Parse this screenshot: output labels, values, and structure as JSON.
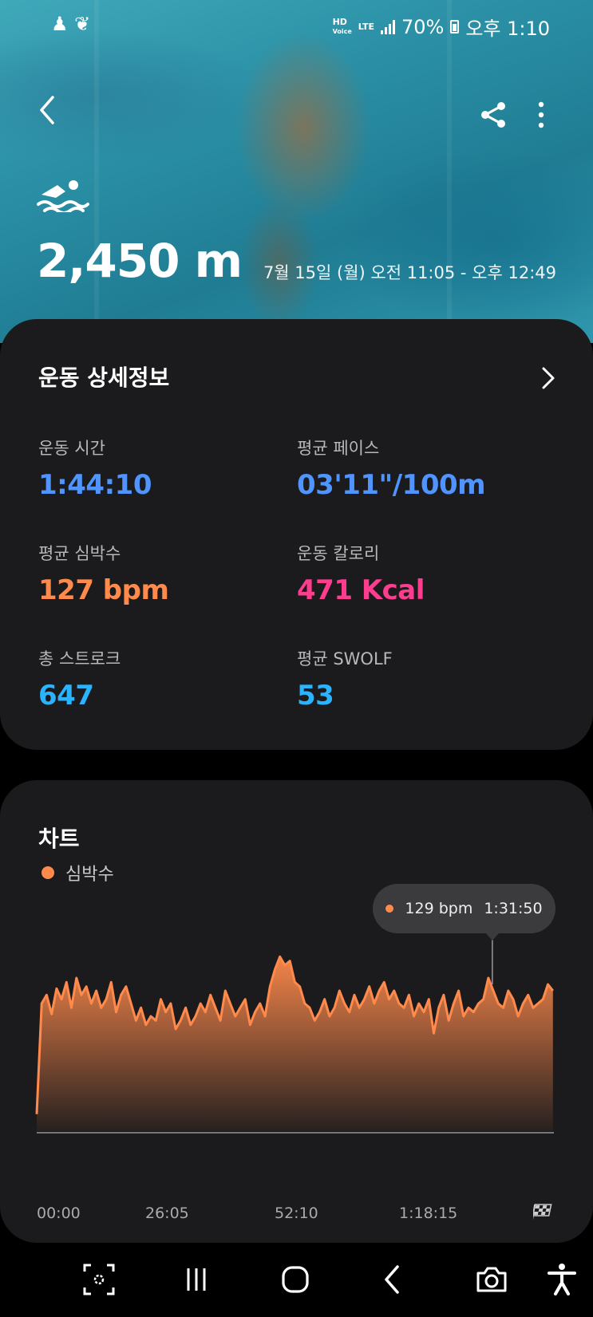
{
  "status_bar": {
    "hd_voice": "HD",
    "voice_sub": "Voice",
    "lte": "LTE",
    "battery": "70%",
    "time": "오후 1:10"
  },
  "hero": {
    "distance": "2,450 m",
    "datetime": "7월 15일 (월) 오전 11:05 - 오후 12:49"
  },
  "details": {
    "title": "운동 상세정보",
    "stats": [
      {
        "label": "운동 시간",
        "value": "1:44:10",
        "color": "#4f94ff"
      },
      {
        "label": "평균 페이스",
        "value": "03'11\"/100m",
        "color": "#4f94ff"
      },
      {
        "label": "평균 심박수",
        "value": "127 bpm",
        "color": "#ff8a4c"
      },
      {
        "label": "운동 칼로리",
        "value": "471 Kcal",
        "color": "#ff3c8e"
      },
      {
        "label": "총 스트로크",
        "value": "647",
        "color": "#2ab3ff"
      },
      {
        "label": "평균 SWOLF",
        "value": "53",
        "color": "#2ab3ff"
      }
    ]
  },
  "chart_card": {
    "title": "차트",
    "legend": "심박수",
    "tooltip_value": "129 bpm",
    "tooltip_time": "1:31:50"
  },
  "chart_data": {
    "type": "area",
    "series_color": "#ff8a4c",
    "x_ticks": [
      "00:00",
      "26:05",
      "52:10",
      "1:18:15"
    ],
    "x_range_minutes": [
      0,
      104.2
    ],
    "y_range_bpm": [
      60,
      150
    ],
    "series": [
      {
        "name": "심박수",
        "x": [
          0,
          1,
          2,
          3,
          4,
          5,
          6,
          7,
          8,
          9,
          10,
          11,
          12,
          13,
          14,
          15,
          16,
          17,
          18,
          19,
          20,
          21,
          22,
          23,
          24,
          25,
          26,
          27,
          28,
          29,
          30,
          31,
          32,
          33,
          34,
          35,
          36,
          37,
          38,
          39,
          40,
          41,
          42,
          43,
          44,
          45,
          46,
          47,
          48,
          49,
          50,
          51,
          52,
          53,
          54,
          55,
          56,
          57,
          58,
          59,
          60,
          61,
          62,
          63,
          64,
          65,
          66,
          67,
          68,
          69,
          70,
          71,
          72,
          73,
          74,
          75,
          76,
          77,
          78,
          79,
          80,
          81,
          82,
          83,
          84,
          85,
          86,
          87,
          88,
          89,
          90,
          91,
          92,
          93,
          94,
          95,
          96,
          97,
          98,
          99,
          100,
          101,
          102,
          103,
          104
        ],
        "values": [
          68,
          120,
          124,
          115,
          127,
          122,
          130,
          118,
          132,
          124,
          128,
          120,
          126,
          118,
          122,
          130,
          116,
          124,
          128,
          120,
          112,
          118,
          110,
          114,
          112,
          122,
          116,
          120,
          108,
          112,
          118,
          110,
          114,
          120,
          116,
          124,
          118,
          112,
          126,
          120,
          114,
          118,
          122,
          110,
          116,
          120,
          114,
          128,
          136,
          142,
          138,
          140,
          130,
          128,
          120,
          118,
          112,
          116,
          122,
          114,
          118,
          126,
          120,
          116,
          124,
          118,
          122,
          128,
          120,
          126,
          130,
          122,
          126,
          120,
          118,
          124,
          114,
          120,
          116,
          122,
          106,
          118,
          124,
          112,
          120,
          126,
          114,
          118,
          116,
          120,
          122,
          132,
          126,
          120,
          118,
          126,
          122,
          114,
          120,
          124,
          118,
          120,
          122,
          129,
          126
        ]
      }
    ],
    "highlight": {
      "x_minutes": 91.8,
      "value_bpm": 129
    }
  },
  "nav": {
    "buttons": [
      "screen-capture",
      "recent-apps",
      "home",
      "back",
      "camera",
      "accessibility"
    ]
  }
}
